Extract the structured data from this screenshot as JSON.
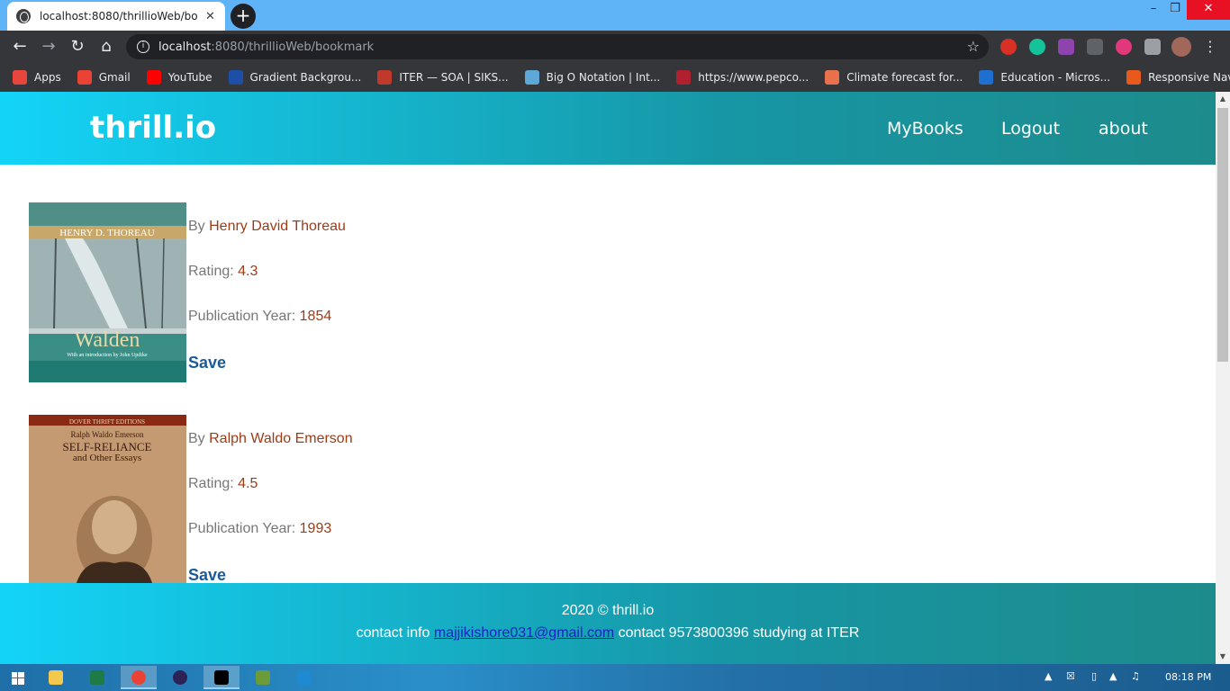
{
  "browser": {
    "tab_title": "localhost:8080/thrillioWeb/bookmark",
    "tab_close": "✕",
    "new_tab": "+",
    "url_host": "localhost",
    "url_path": ":8080/thrillioWeb/bookmark",
    "bookmarks": [
      {
        "label": "Apps",
        "color": "#e8453c"
      },
      {
        "label": "Gmail",
        "color": "#ea4335"
      },
      {
        "label": "YouTube",
        "color": "#ff0000"
      },
      {
        "label": "Gradient Backgrou...",
        "color": "#1e4fa8"
      },
      {
        "label": "ITER — SOA | SIKS...",
        "color": "#c0392b"
      },
      {
        "label": "Big O Notation | Int...",
        "color": "#5ea8d8"
      },
      {
        "label": "https://www.pepco...",
        "color": "#b0202f"
      },
      {
        "label": "Climate forecast for...",
        "color": "#e8704a"
      },
      {
        "label": "Education - Micros...",
        "color": "#1f6fd0"
      },
      {
        "label": "Responsive Navigat...",
        "color": "#e85a1c"
      }
    ]
  },
  "site": {
    "brand": "thrill.io",
    "nav": [
      "MyBooks",
      "Logout",
      "about"
    ]
  },
  "books": [
    {
      "by_label": "By ",
      "author": "Henry David Thoreau",
      "rating_label": "Rating: ",
      "rating": "4.3",
      "year_label": "Publication Year: ",
      "year": "1854",
      "save": "Save",
      "cover": {
        "top_text": "HENRY D. THOREAU",
        "title": "Walden",
        "subtitle": "With an introduction by John Updike"
      }
    },
    {
      "by_label": "By ",
      "author": "Ralph Waldo Emerson",
      "rating_label": "Rating: ",
      "rating": "4.5",
      "year_label": "Publication Year: ",
      "year": "1993",
      "save": "Save",
      "cover": {
        "top_text": "DOVER THRIFT EDITIONS",
        "author": "Ralph Waldo Emerson",
        "title": "SELF-RELIANCE",
        "subtitle": "and Other Essays"
      }
    }
  ],
  "footer": {
    "copyright": "2020 © thrill.io",
    "contact_prefix": "contact info ",
    "email": "majjikishore031@gmail.com",
    "contact_suffix": " contact 9573800396 studying at ITER"
  },
  "taskbar": {
    "clock": "08:18 PM"
  }
}
